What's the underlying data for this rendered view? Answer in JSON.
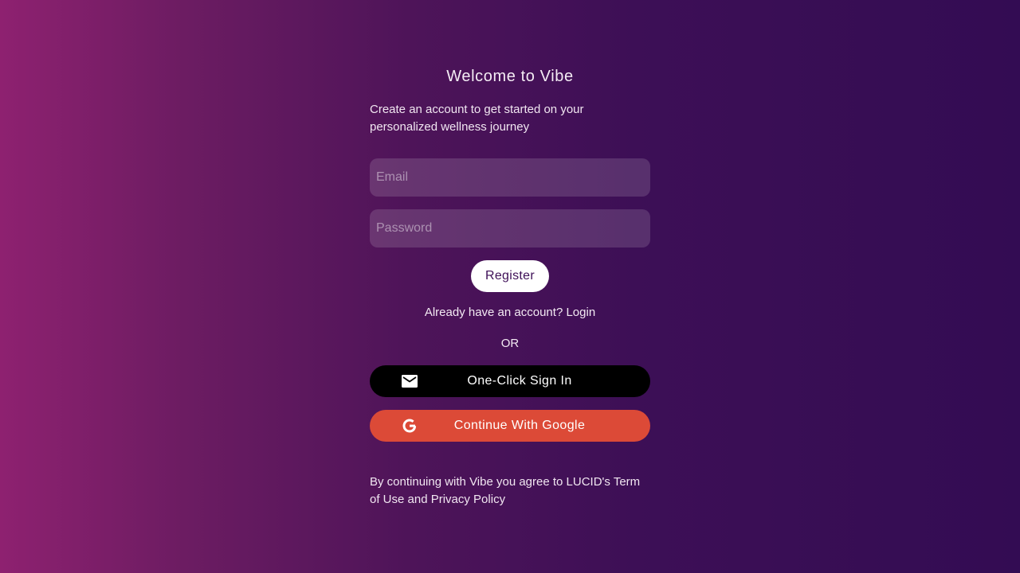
{
  "header": {
    "title": "Welcome to Vibe",
    "subtitle": "Create an account to get started on your personalized wellness journey"
  },
  "form": {
    "email_placeholder": "Email",
    "password_placeholder": "Password",
    "register_label": "Register"
  },
  "login_prompt": {
    "text": "Already have an account? ",
    "link_label": "Login"
  },
  "divider": {
    "label": "OR"
  },
  "social": {
    "oneclick": {
      "label": "One-Click Sign In",
      "icon": "mail-icon",
      "background": "#000000"
    },
    "google": {
      "label": "Continue With Google",
      "icon": "google-icon",
      "background": "#dc4a37"
    }
  },
  "footer": {
    "terms": "By continuing with Vibe you agree to LUCID's Term of Use and Privacy Policy"
  },
  "colors": {
    "gradient_start": "#8e2170",
    "gradient_end": "#330c53",
    "register_text": "#3e0f57"
  }
}
